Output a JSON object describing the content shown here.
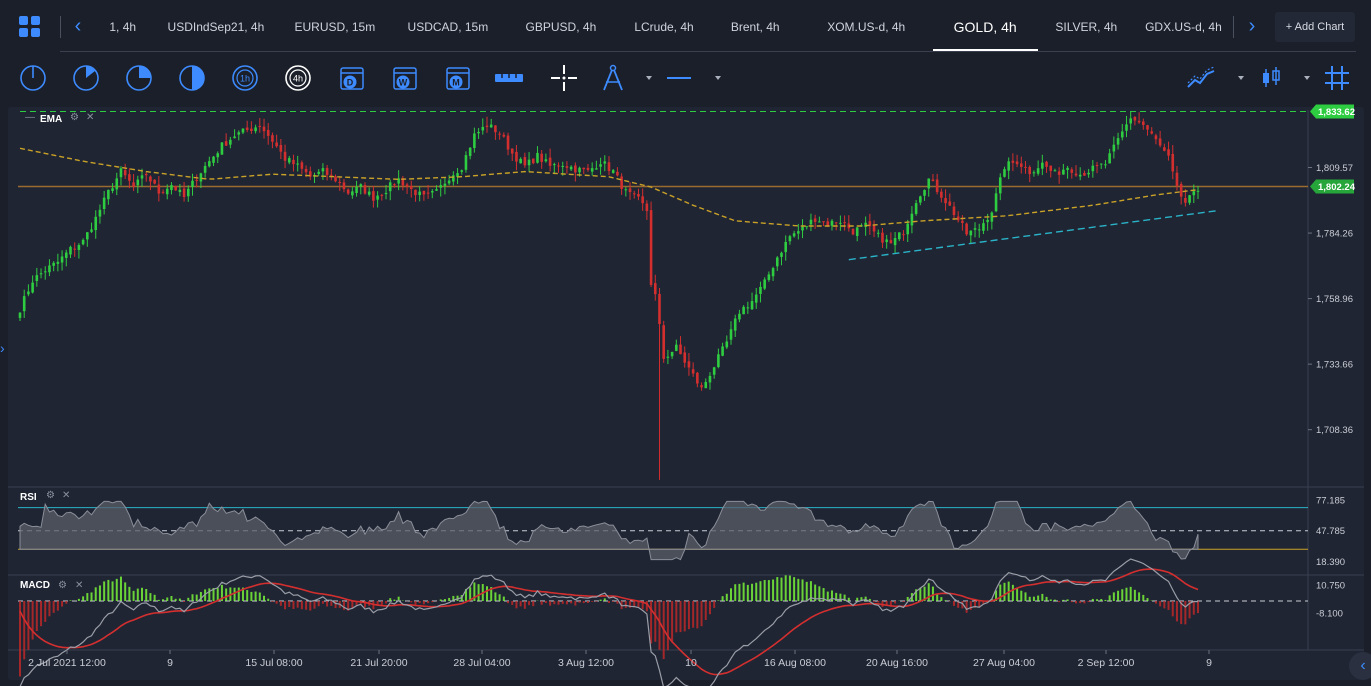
{
  "tabs": [
    "1, 4h",
    "USDIndSep21, 4h",
    "EURUSD, 15m",
    "USDCAD, 15m",
    "GBPUSD, 4h",
    "LCrude, 4h",
    "Brent, 4h",
    "XOM.US-d, 4h",
    "GOLD, 4h",
    "SILVER, 4h",
    "GDX.US-d, 4h"
  ],
  "active_tab": "GOLD, 4h",
  "add_chart_label": "+ Add Chart",
  "toolbar": {
    "icons": [
      "clock-1-icon",
      "clock-2-icon",
      "clock-3-icon",
      "clock-4-icon",
      "1h-timeframe-icon",
      "4h-timeframe-icon",
      "daily-calendar-icon",
      "weekly-calendar-icon",
      "monthly-calendar-icon",
      "ruler-icon",
      "crosshair-icon",
      "drawing-compass-icon",
      "line-style-icon",
      "line-chart-type-icon",
      "candlestick-type-icon",
      "grid-icon"
    ],
    "tf_1h": "1h",
    "tf_4h": "4h",
    "cal_d": "D",
    "cal_w": "W",
    "cal_m": "M"
  },
  "colors": {
    "bull": "#2ecc40",
    "bear": "#d32f2f",
    "ema": "#c9a227",
    "support_line": "#2ab3c8",
    "horizontal_line": "#9a6b2f",
    "top_dashed": "#2ecc40",
    "accent": "#3d8bff"
  },
  "chart_data": {
    "type": "candlestick",
    "symbol": "GOLD",
    "timeframe": "4h",
    "indicators": {
      "main": "EMA",
      "rsi": "RSI",
      "macd": "MACD"
    },
    "y_ticks": [
      "1,809.57",
      "1,784.26",
      "1,758.96",
      "1,733.66",
      "1,708.36"
    ],
    "y_tick_values": [
      1809.57,
      1784.26,
      1758.96,
      1733.66,
      1708.36
    ],
    "ylim": [
      1687,
      1831
    ],
    "current_price": "1,802.24",
    "current_price_value": 1802.24,
    "top_price_tag": "1,833.62",
    "top_dashed_value": 1831.2,
    "horizontal_line_value": 1802.24,
    "x_labels": [
      "2 Jul 2021 12:00",
      "9",
      "15 Jul 08:00",
      "21 Jul 20:00",
      "28 Jul 04:00",
      "3 Aug 12:00",
      "10",
      "16 Aug 08:00",
      "20 Aug 16:00",
      "27 Aug 04:00",
      "2 Sep 12:00",
      "9"
    ],
    "close_anchors": [
      [
        0,
        1755
      ],
      [
        3,
        1766
      ],
      [
        6,
        1770
      ],
      [
        9,
        1773
      ],
      [
        12,
        1778
      ],
      [
        15,
        1781
      ],
      [
        18,
        1790
      ],
      [
        21,
        1800
      ],
      [
        24,
        1808
      ],
      [
        27,
        1802
      ],
      [
        30,
        1807
      ],
      [
        33,
        1800
      ],
      [
        36,
        1803
      ],
      [
        39,
        1798
      ],
      [
        42,
        1806
      ],
      [
        45,
        1812
      ],
      [
        48,
        1818
      ],
      [
        51,
        1822
      ],
      [
        54,
        1824
      ],
      [
        57,
        1826
      ],
      [
        60,
        1820
      ],
      [
        63,
        1813
      ],
      [
        66,
        1810
      ],
      [
        69,
        1806
      ],
      [
        72,
        1808
      ],
      [
        75,
        1805
      ],
      [
        78,
        1800
      ],
      [
        81,
        1802
      ],
      [
        84,
        1798
      ],
      [
        87,
        1801
      ],
      [
        90,
        1805
      ],
      [
        93,
        1801
      ],
      [
        96,
        1798
      ],
      [
        99,
        1800
      ],
      [
        102,
        1806
      ],
      [
        105,
        1810
      ],
      [
        108,
        1822
      ],
      [
        111,
        1826
      ],
      [
        114,
        1823
      ],
      [
        117,
        1815
      ],
      [
        120,
        1810
      ],
      [
        123,
        1814
      ],
      [
        126,
        1810
      ],
      [
        129,
        1811
      ],
      [
        132,
        1809
      ],
      [
        135,
        1808
      ],
      [
        138,
        1812
      ],
      [
        141,
        1808
      ],
      [
        144,
        1800
      ],
      [
        147,
        1797
      ],
      [
        149,
        1793
      ],
      [
        150,
        1765
      ],
      [
        151,
        1760
      ],
      [
        153,
        1736
      ],
      [
        156,
        1740
      ],
      [
        159,
        1732
      ],
      [
        162,
        1724
      ],
      [
        165,
        1733
      ],
      [
        168,
        1742
      ],
      [
        171,
        1754
      ],
      [
        174,
        1758
      ],
      [
        177,
        1765
      ],
      [
        180,
        1775
      ],
      [
        183,
        1783
      ],
      [
        186,
        1786
      ],
      [
        189,
        1790
      ],
      [
        192,
        1788
      ],
      [
        195,
        1789
      ],
      [
        198,
        1785
      ],
      [
        201,
        1787
      ],
      [
        204,
        1783
      ],
      [
        207,
        1780
      ],
      [
        210,
        1785
      ],
      [
        213,
        1797
      ],
      [
        216,
        1805
      ],
      [
        219,
        1799
      ],
      [
        222,
        1792
      ],
      [
        225,
        1784
      ],
      [
        228,
        1786
      ],
      [
        231,
        1793
      ],
      [
        234,
        1810
      ],
      [
        237,
        1812
      ],
      [
        240,
        1808
      ],
      [
        243,
        1811
      ],
      [
        246,
        1807
      ],
      [
        249,
        1810
      ],
      [
        252,
        1807
      ],
      [
        255,
        1809
      ],
      [
        258,
        1811
      ],
      [
        261,
        1820
      ],
      [
        264,
        1829
      ],
      [
        267,
        1826
      ],
      [
        270,
        1820
      ],
      [
        273,
        1813
      ],
      [
        275,
        1801
      ],
      [
        277,
        1796
      ],
      [
        279,
        1799
      ],
      [
        280,
        1801
      ]
    ],
    "ema_anchors": [
      [
        0,
        1817
      ],
      [
        15,
        1812
      ],
      [
        30,
        1808
      ],
      [
        45,
        1805
      ],
      [
        60,
        1807
      ],
      [
        75,
        1806
      ],
      [
        90,
        1805
      ],
      [
        105,
        1806
      ],
      [
        120,
        1808
      ],
      [
        140,
        1806
      ],
      [
        150,
        1802
      ],
      [
        160,
        1795
      ],
      [
        170,
        1789
      ],
      [
        185,
        1787
      ],
      [
        200,
        1787
      ],
      [
        215,
        1789
      ],
      [
        235,
        1791
      ],
      [
        255,
        1795
      ],
      [
        270,
        1799
      ],
      [
        280,
        1801
      ]
    ],
    "support_line": [
      [
        197,
        1774
      ],
      [
        285,
        1793
      ]
    ],
    "rsi": {
      "label": "RSI",
      "ticks": [
        "77.185",
        "47.785",
        "18.390"
      ],
      "tick_values": [
        77.185,
        47.785,
        18.39
      ],
      "overbought": 70,
      "oversold": 30,
      "ylim": [
        10,
        85
      ]
    },
    "macd": {
      "label": "MACD",
      "ticks": [
        "10.750",
        "-8.100"
      ],
      "tick_values": [
        10.75,
        -8.1
      ],
      "ylim": [
        -30,
        14
      ]
    }
  }
}
